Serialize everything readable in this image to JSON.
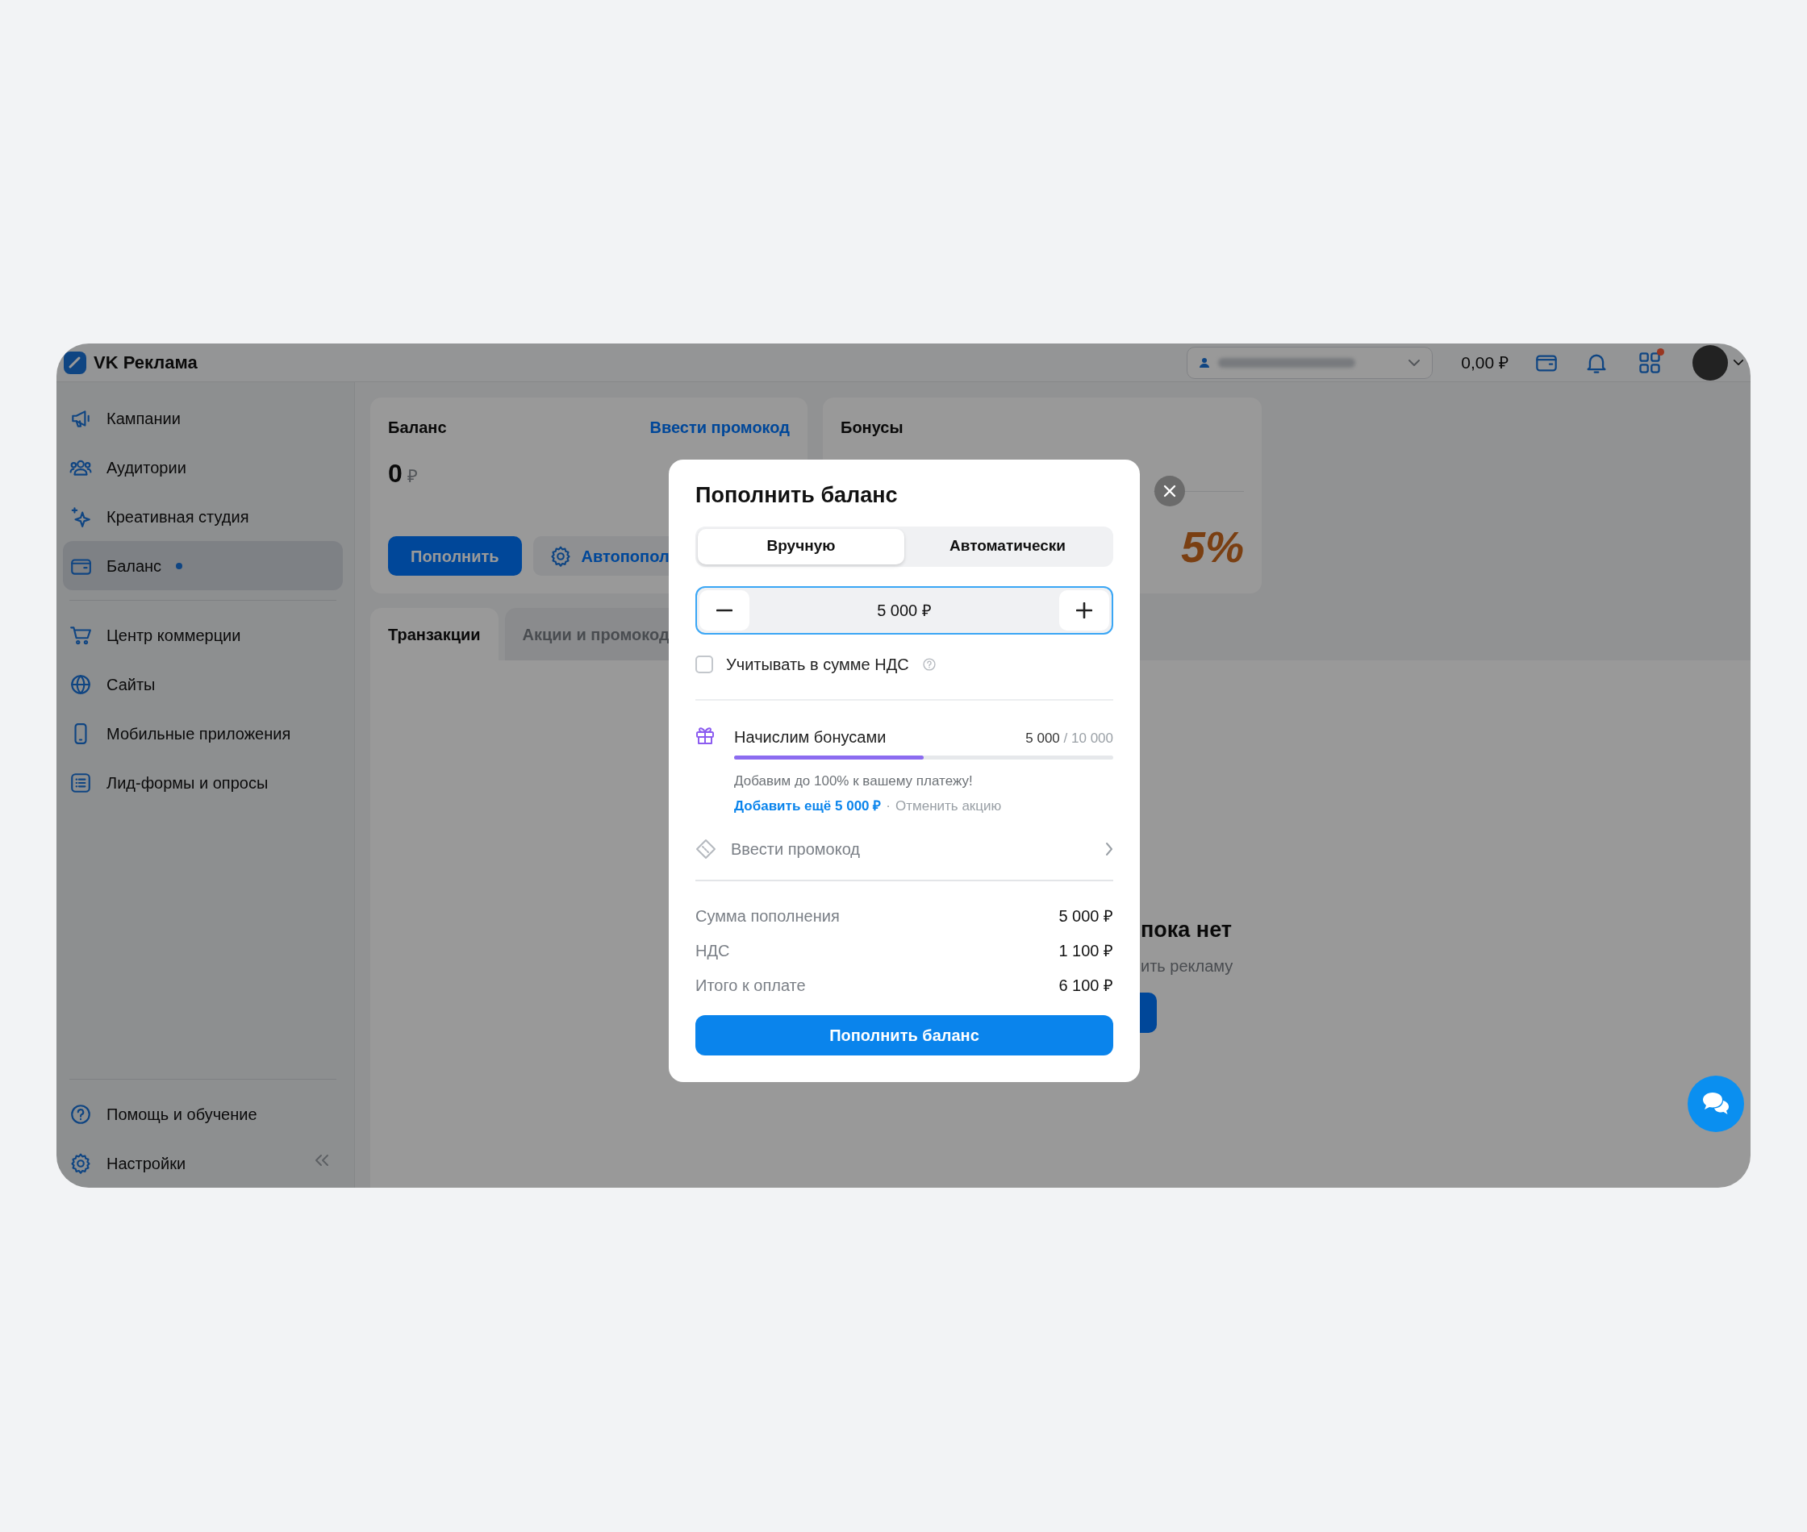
{
  "top_bar": {
    "logo_text": "VK Реклама",
    "balance": "0,00 ₽",
    "apps_badge": true
  },
  "sidebar": {
    "items": [
      {
        "label": "Кампании",
        "selected": false,
        "dot": false
      },
      {
        "label": "Аудитории",
        "selected": false,
        "dot": false
      },
      {
        "label": "Креативная студия",
        "selected": false,
        "dot": false
      },
      {
        "label": "Баланс",
        "selected": true,
        "dot": true
      },
      {
        "label": "Центр коммерции",
        "selected": false,
        "dot": false
      },
      {
        "label": "Сайты",
        "selected": false,
        "dot": false
      },
      {
        "label": "Мобильные приложения",
        "selected": false,
        "dot": false
      },
      {
        "label": "Лид-формы и опросы",
        "selected": false,
        "dot": false
      }
    ],
    "footer_items": [
      {
        "label": "Помощь и обучение"
      },
      {
        "label": "Настройки"
      }
    ]
  },
  "balance_card": {
    "title": "Баланс",
    "promo_link": "Ввести промокод",
    "amount": "0",
    "currency": "₽",
    "buttons": [
      {
        "label": "Пополнить",
        "kind": "primary"
      },
      {
        "label": "Автопопол",
        "kind": "secondary"
      }
    ]
  },
  "bonus_card": {
    "title": "Бонусы",
    "promo_badge": "5%"
  },
  "tabs": [
    {
      "label": "Транзакции",
      "selected": true
    },
    {
      "label": "Акции и промокод",
      "selected": false
    }
  ],
  "empty_state": {
    "title": "пока нет",
    "subtitle": "ить рекламу"
  },
  "modal": {
    "title": "Пополнить баланс",
    "modes": [
      {
        "label": "Вручную",
        "selected": true
      },
      {
        "label": "Автоматически",
        "selected": false
      }
    ],
    "amount": "5 000 ₽",
    "vat_checkbox": {
      "label": "Учитывать в сумме НДС",
      "checked": false
    },
    "bonus": {
      "title": "Начислим бонусами",
      "current": "5 000",
      "limit": "/ 10 000",
      "level": 0.5,
      "note": "Добавим до 100% к вашему платежу!",
      "add_link": "Добавить ещё 5 000 ₽",
      "separator": "·",
      "cancel_link": "Отменить акцию"
    },
    "promo": {
      "label": "Ввести промокод"
    },
    "summary": [
      {
        "label": "Сумма пополнения",
        "value": "5 000 ₽"
      },
      {
        "label": "НДС",
        "value": "1 100 ₽"
      },
      {
        "label": "Итого к оплате",
        "value": "6 100 ₽"
      }
    ],
    "submit": "Пополнить баланс"
  }
}
